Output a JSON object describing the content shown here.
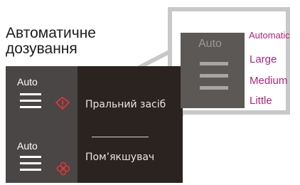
{
  "title": {
    "line1": "Автоматичне",
    "line2": "дозування"
  },
  "rows": [
    {
      "auto_label": "Auto",
      "text": "Пральний засіб",
      "icon": "detergent-warning-icon"
    },
    {
      "auto_label": "Auto",
      "text": "Пом’якшувач",
      "icon": "softener-flower-icon"
    }
  ],
  "callout": {
    "auto_label": "Auto",
    "options": [
      "Automatic",
      "Large",
      "Medium",
      "Little"
    ]
  },
  "colors": {
    "panel_bg": "#2b2320",
    "left_col_bg": "#4a4645",
    "accent_red": "#e0343a",
    "option_text": "#b0237a",
    "callout_border": "#c8c8c8"
  }
}
